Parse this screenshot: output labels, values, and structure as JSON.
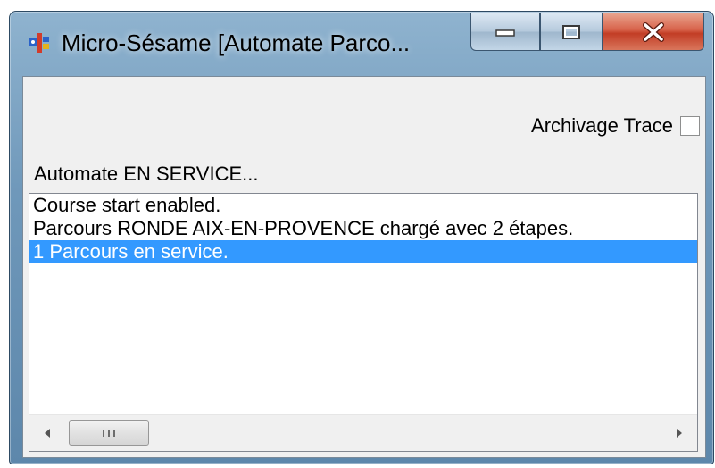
{
  "window": {
    "title": "Micro-Sésame [Automate Parco...",
    "title_icon": "app-icon",
    "minimize_icon": "minimize-icon",
    "maximize_icon": "maximize-icon",
    "close_icon": "close-icon"
  },
  "options": {
    "archivage_label": "Archivage Trace",
    "archivage_checked": false
  },
  "status": {
    "text": "Automate EN SERVICE..."
  },
  "log": {
    "items": [
      "Course start enabled.",
      "Parcours RONDE AIX-EN-PROVENCE chargé avec 2 étapes.",
      "1 Parcours en service."
    ],
    "selected_index": 2
  },
  "scrollbar": {
    "left_icon": "scroll-left-icon",
    "right_icon": "scroll-right-icon",
    "thumb_icon": "grip-icon"
  },
  "colors": {
    "selection": "#3399ff",
    "close_button": "#c94a30"
  }
}
